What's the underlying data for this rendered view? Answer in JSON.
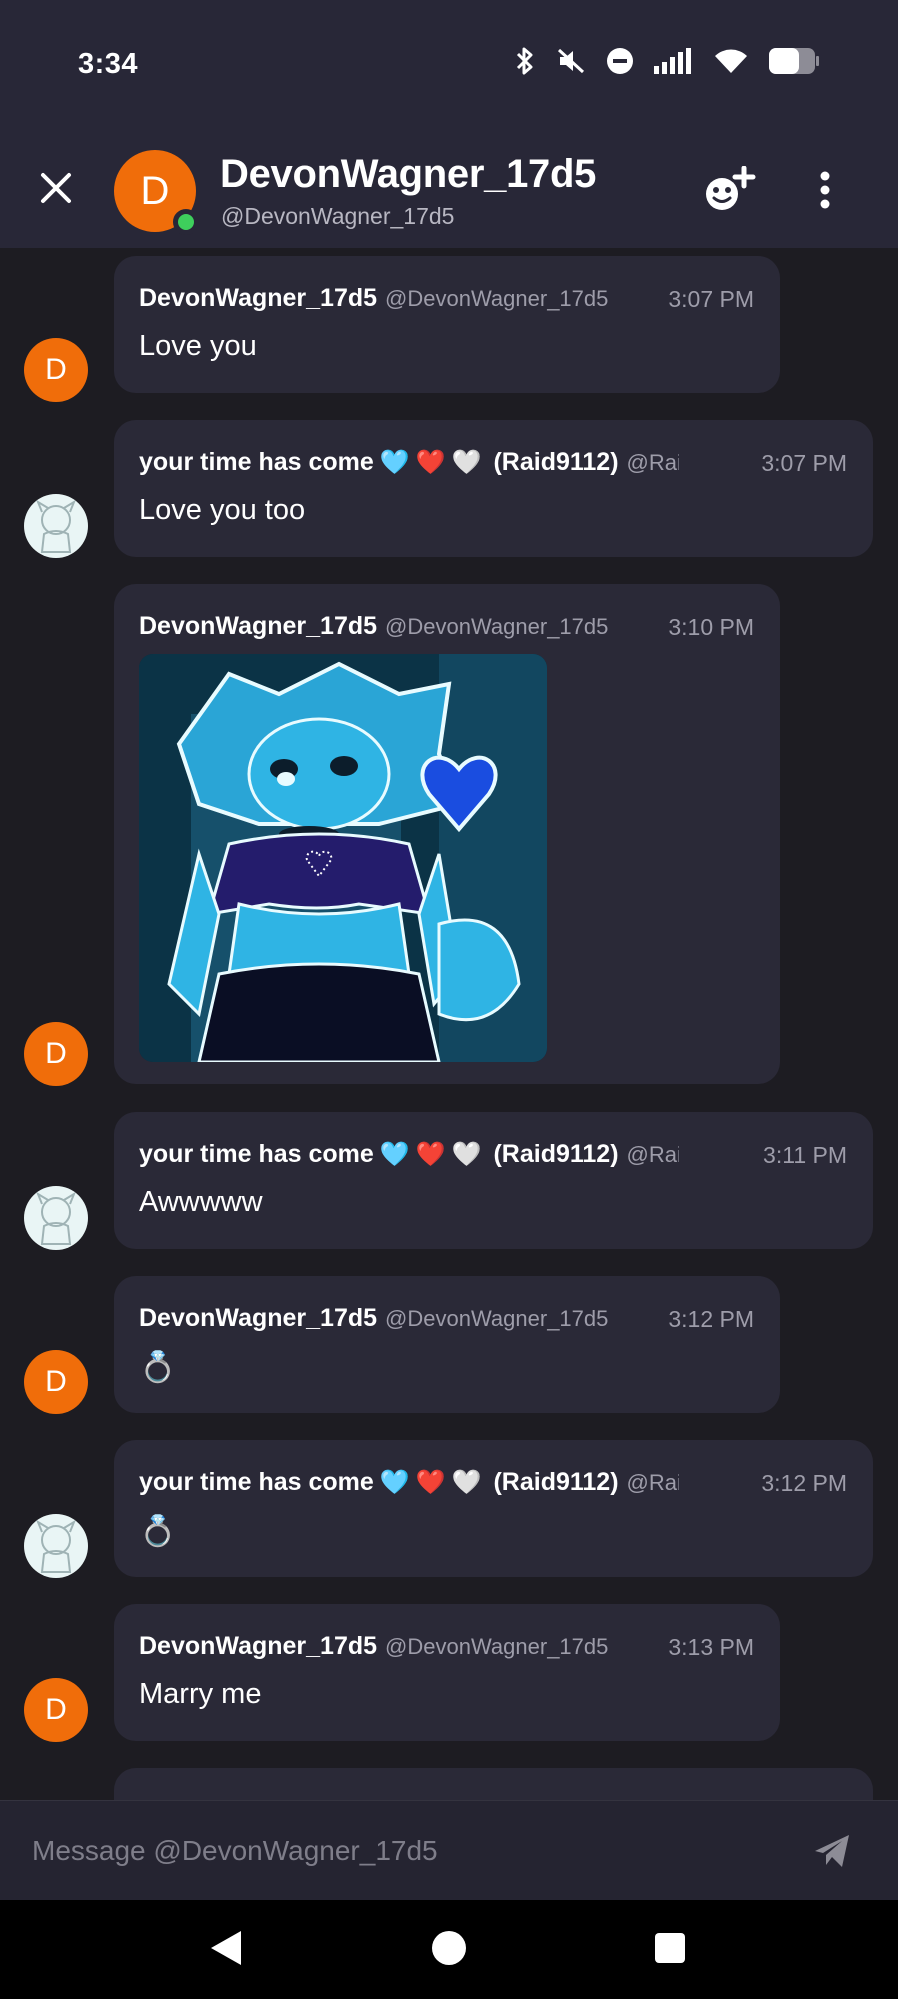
{
  "status_bar": {
    "time": "3:34"
  },
  "header": {
    "avatar_letter": "D",
    "title": "DevonWagner_17d5",
    "handle": "@DevonWagner_17d5"
  },
  "colors": {
    "accent_orange": "#f06d0a",
    "online_green": "#3ecf5c",
    "bubble": "#2a2937",
    "header": "#282737"
  },
  "messages": [
    {
      "author": "DevonWagner_17d5",
      "handle": "@DevonWagner_17d5",
      "time": "3:07 PM",
      "text": "Love you",
      "avatar_letter": "D"
    },
    {
      "author": "your time has come",
      "hearts": "🩵❤️🤍",
      "author_suffix": "(Raid9112)",
      "handle": "@Raid",
      "time": "3:07 PM",
      "text": "Love you too"
    },
    {
      "author": "DevonWagner_17d5",
      "handle": "@DevonWagner_17d5",
      "time": "3:10 PM",
      "attachment": "image",
      "avatar_letter": "D"
    },
    {
      "author": "your time has come",
      "hearts": "🩵❤️🤍",
      "author_suffix": "(Raid9112)",
      "handle": "@Raid",
      "time": "3:11 PM",
      "text": "Awwwww"
    },
    {
      "author": "DevonWagner_17d5",
      "handle": "@DevonWagner_17d5",
      "time": "3:12 PM",
      "text": "💍",
      "avatar_letter": "D"
    },
    {
      "author": "your time has come",
      "hearts": "🩵❤️🤍",
      "author_suffix": "(Raid9112)",
      "handle": "@Raid",
      "time": "3:12 PM",
      "text": "💍"
    },
    {
      "author": "DevonWagner_17d5",
      "handle": "@DevonWagner_17d5",
      "time": "3:13 PM",
      "text": "Marry me",
      "avatar_letter": "D"
    }
  ],
  "composer": {
    "placeholder": "Message @DevonWagner_17d5"
  }
}
